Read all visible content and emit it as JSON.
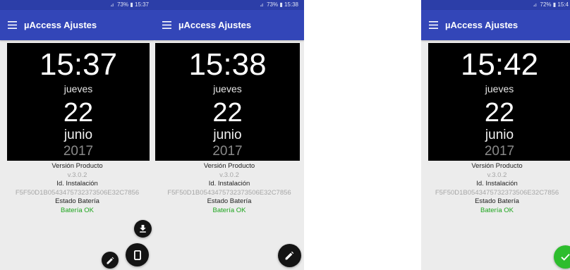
{
  "screens": [
    {
      "status": {
        "signal": "⊿",
        "battery_text": "73%",
        "time": "15:37"
      },
      "app_title": "µAccess Ajustes",
      "clock": {
        "time": "15:37",
        "weekday": "jueves",
        "day": "22",
        "month": "junio",
        "year": "2017"
      },
      "info": {
        "version_label": "Versión Producto",
        "version_value": "v.3.0.2",
        "install_label": "Id. Instalación",
        "install_value": "F5F50D1B0543475732373506E32C7856",
        "battery_label": "Estado Batería",
        "battery_value": "Batería OK"
      },
      "fabs": [
        "download-fab",
        "device-fab",
        "edit-fab"
      ]
    },
    {
      "status": {
        "signal": "⊿",
        "battery_text": "73%",
        "time": "15:38"
      },
      "app_title": "µAccess Ajustes",
      "clock": {
        "time": "15:38",
        "weekday": "jueves",
        "day": "22",
        "month": "junio",
        "year": "2017"
      },
      "info": {
        "version_label": "Versión Producto",
        "version_value": "v.3.0.2",
        "install_label": "Id. Instalación",
        "install_value": "F5F50D1B0543475732373506E32C7856",
        "battery_label": "Estado Batería",
        "battery_value": "Batería OK"
      },
      "fabs": [
        "edit-fab"
      ]
    },
    {
      "status": {
        "signal": "⊿",
        "battery_text": "72%",
        "time": "15:4"
      },
      "app_title": "µAccess Ajustes",
      "clock": {
        "time": "15:42",
        "weekday": "jueves",
        "day": "22",
        "month": "junio",
        "year": "2017"
      },
      "info": {
        "version_label": "Versión Producto",
        "version_value": "v.3.0.2",
        "install_label": "Id. Instalación",
        "install_value": "F5F50D1B0543475732373506E32C7856",
        "battery_label": "Estado Batería",
        "battery_value": "Batería OK"
      },
      "fabs": [
        "confirm-fab"
      ]
    }
  ],
  "icons": {
    "menu": "hamburger-menu-icon",
    "download": "download-icon",
    "device": "smartphone-icon",
    "edit": "pencil-icon",
    "confirm": "checkmark-icon"
  },
  "colors": {
    "status_bar": "#2c3ea8",
    "app_bar": "#3346b8",
    "clock_bg": "#000000",
    "ok_text": "#1ea51e",
    "fab_dark": "#141414",
    "fab_confirm": "#2dbd2d"
  }
}
